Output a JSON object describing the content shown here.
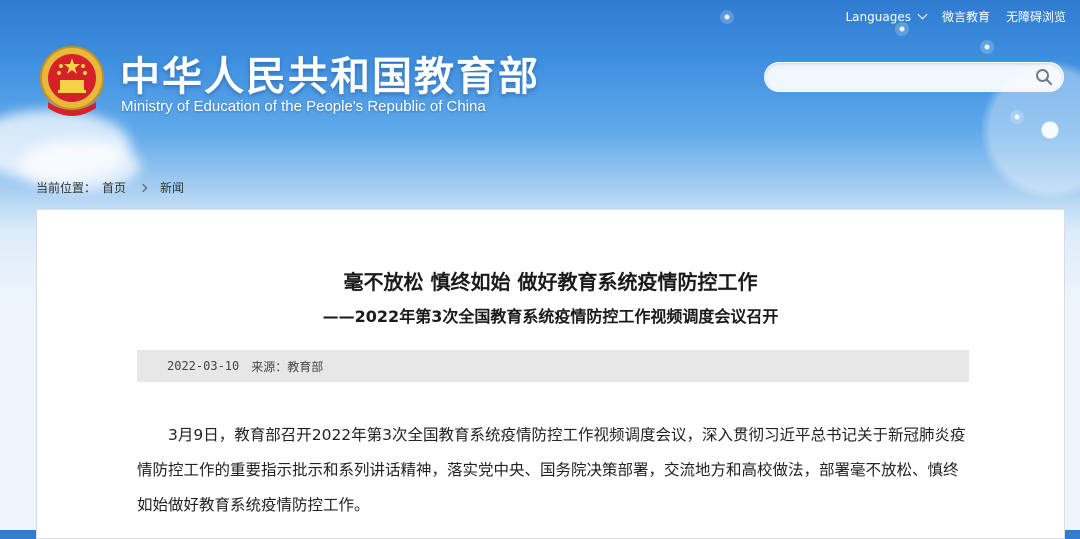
{
  "topbar": {
    "languages_label": "Languages",
    "weiyan_label": "微言教育",
    "accessibility_label": "无障碍浏览"
  },
  "header": {
    "title_cn": "中华人民共和国教育部",
    "title_en": "Ministry of Education of the People's Republic of China",
    "emblem_icon": "national-emblem-icon"
  },
  "search": {
    "placeholder": "",
    "value": "",
    "icon": "search-icon"
  },
  "breadcrumb": {
    "prefix": "当前位置：",
    "home": "首页",
    "current": "新闻"
  },
  "article": {
    "title": "毫不放松 慎终如始 做好教育系统疫情防控工作",
    "subtitle": "——2022年第3次全国教育系统疫情防控工作视频调度会议召开",
    "date": "2022-03-10",
    "source": "来源：教育部",
    "body": "3月9日，教育部召开2022年第3次全国教育系统疫情防控工作视频调度会议，深入贯彻习近平总书记关于新冠肺炎疫情防控工作的重要指示批示和系列讲话精神，落实党中央、国务院决策部署，交流地方和高校做法，部署毫不放松、慎终如始做好教育系统疫情防控工作。"
  },
  "colors": {
    "header_blue": "#2f7bd0",
    "text_dark": "#1a1a1a",
    "meta_bg": "#e7e7e7"
  }
}
